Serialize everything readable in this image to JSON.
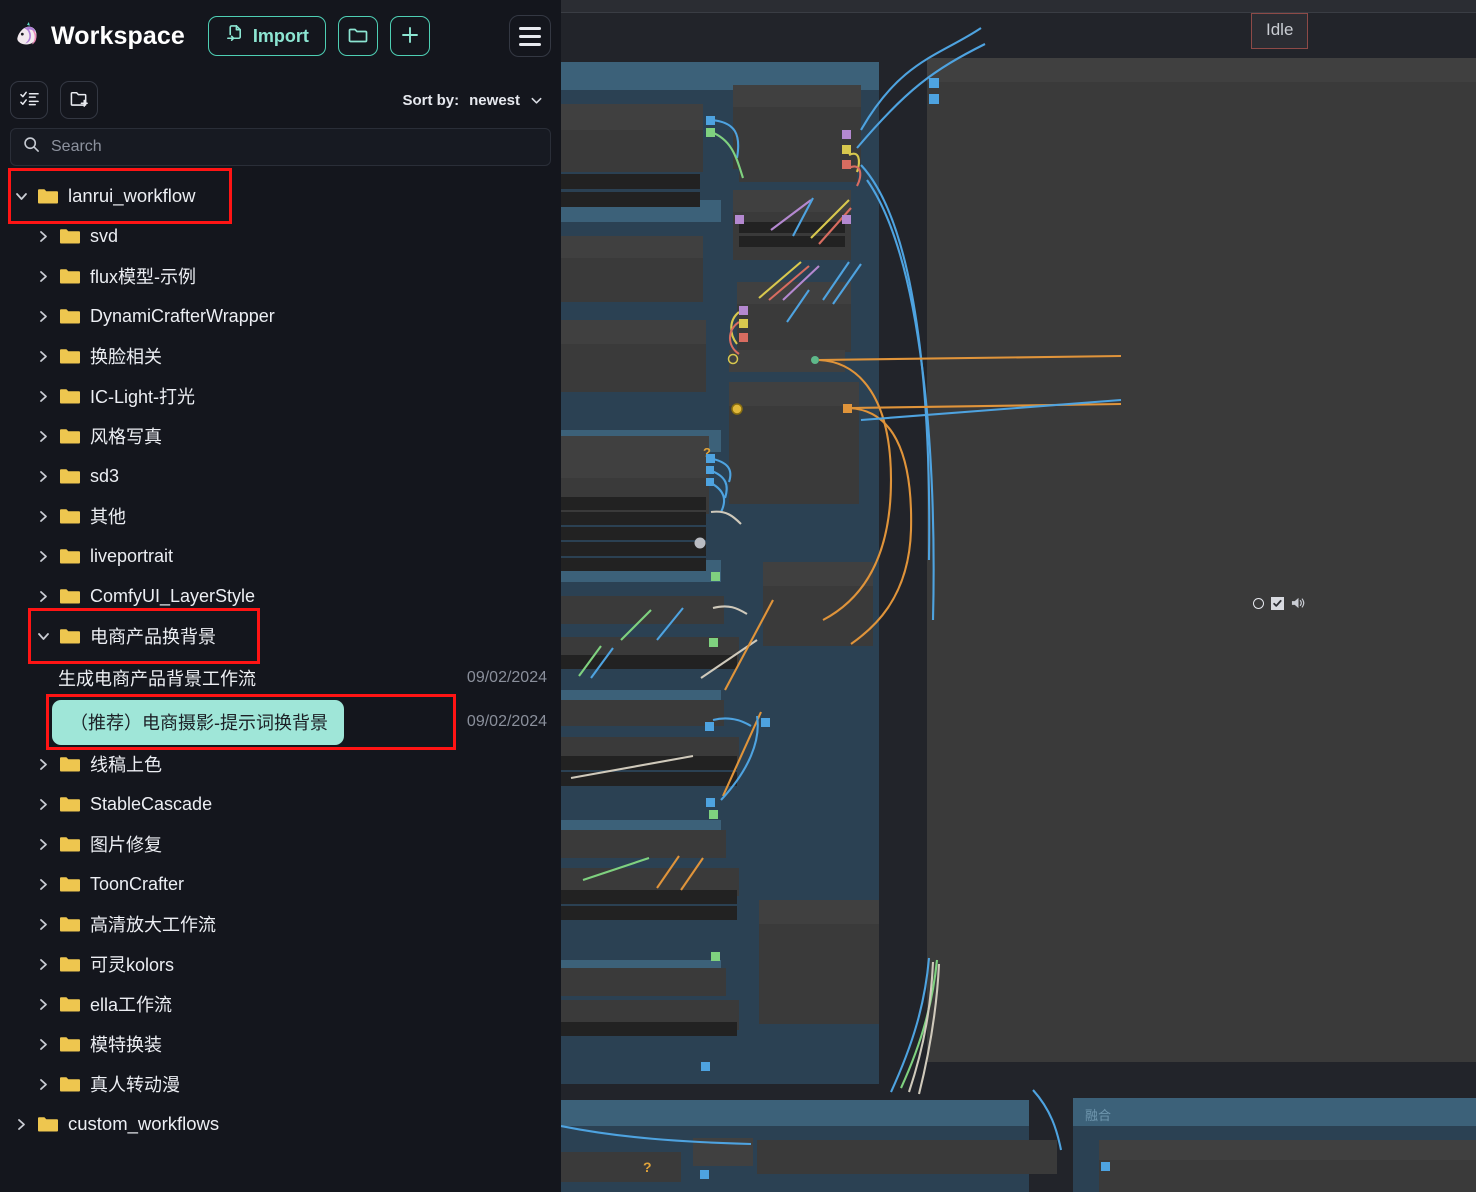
{
  "sidebar": {
    "title": "Workspace",
    "logo_icon": "unicorn-logo",
    "import_label": "Import",
    "import_icon": "file-import-icon",
    "new_folder_icon": "folder-icon",
    "add_icon": "plus-icon",
    "menu_icon": "hamburger-menu-icon",
    "list_view_icon": "checklist-icon",
    "create_folder_icon": "folder-plus-icon",
    "sort_label": "Sort by:",
    "sort_value": "newest",
    "sort_chevron_icon": "chevron-down-icon",
    "search_placeholder": "Search",
    "search_value": "",
    "search_icon": "search-icon",
    "accent_color": "#7fe0cf",
    "selected_pill_color": "#9fe6d8",
    "highlight_box_color": "#ff1414",
    "folder_icon_color": "#eec64f",
    "tree": [
      {
        "label": "lanrui_workflow",
        "level": 0,
        "expanded": true,
        "type": "folder",
        "highlighted": true
      },
      {
        "label": "svd",
        "level": 1,
        "expanded": false,
        "type": "folder"
      },
      {
        "label": "flux模型-示例",
        "level": 1,
        "expanded": false,
        "type": "folder"
      },
      {
        "label": "DynamiCrafterWrapper",
        "level": 1,
        "expanded": false,
        "type": "folder"
      },
      {
        "label": "换脸相关",
        "level": 1,
        "expanded": false,
        "type": "folder"
      },
      {
        "label": "IC-Light-打光",
        "level": 1,
        "expanded": false,
        "type": "folder"
      },
      {
        "label": "风格写真",
        "level": 1,
        "expanded": false,
        "type": "folder"
      },
      {
        "label": "sd3",
        "level": 1,
        "expanded": false,
        "type": "folder"
      },
      {
        "label": "其他",
        "level": 1,
        "expanded": false,
        "type": "folder"
      },
      {
        "label": "liveportrait",
        "level": 1,
        "expanded": false,
        "type": "folder"
      },
      {
        "label": "ComfyUI_LayerStyle",
        "level": 1,
        "expanded": false,
        "type": "folder"
      },
      {
        "label": "电商产品换背景",
        "level": 1,
        "expanded": true,
        "type": "folder",
        "highlighted": true
      },
      {
        "label": "生成电商产品背景工作流",
        "level": 2,
        "type": "workflow",
        "date": "09/02/2024",
        "selected": false
      },
      {
        "label": "（推荐）电商摄影-提示词换背景",
        "level": 2,
        "type": "workflow",
        "date": "09/02/2024",
        "selected": true,
        "highlighted": true
      },
      {
        "label": "线稿上色",
        "level": 1,
        "expanded": false,
        "type": "folder"
      },
      {
        "label": "StableCascade",
        "level": 1,
        "expanded": false,
        "type": "folder"
      },
      {
        "label": "图片修复",
        "level": 1,
        "expanded": false,
        "type": "folder"
      },
      {
        "label": "ToonCrafter",
        "level": 1,
        "expanded": false,
        "type": "folder"
      },
      {
        "label": "高清放大工作流",
        "level": 1,
        "expanded": false,
        "type": "folder"
      },
      {
        "label": "可灵kolors",
        "level": 1,
        "expanded": false,
        "type": "folder"
      },
      {
        "label": "ella工作流",
        "level": 1,
        "expanded": false,
        "type": "folder"
      },
      {
        "label": "模特换装",
        "level": 1,
        "expanded": false,
        "type": "folder"
      },
      {
        "label": "真人转动漫",
        "level": 1,
        "expanded": false,
        "type": "folder"
      },
      {
        "label": "custom_workflows",
        "level": 0,
        "expanded": false,
        "type": "folder"
      }
    ]
  },
  "canvas": {
    "status_badge": "Idle",
    "status_border_color": "#8e4a47",
    "group_labels": [
      "融合"
    ],
    "radio_icon": "radio-unchecked-icon",
    "checkbox_icon": "checkbox-checked-icon",
    "speaker_icon": "speaker-icon",
    "background_color": "#22242a",
    "group_header_color": "#3c6179",
    "group_body_color": "#2c4254",
    "node_color": "#3a3a3a",
    "wire_colors": [
      "#4ea3e0",
      "#e0943a",
      "#7fd17f",
      "#d9d2c2",
      "#c9c06a"
    ]
  }
}
